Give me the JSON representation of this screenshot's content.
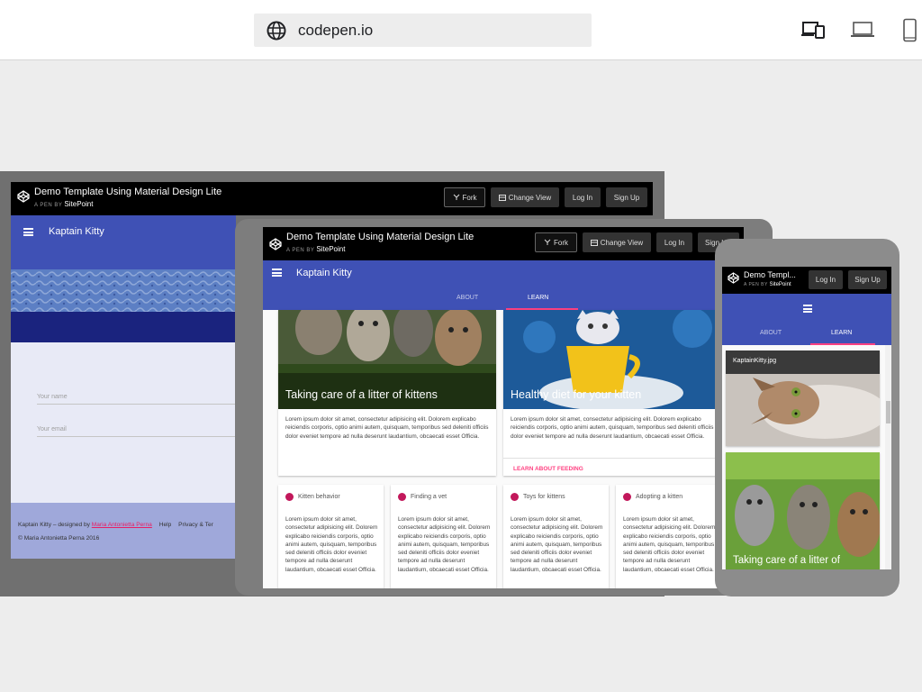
{
  "browser": {
    "url": "codepen.io",
    "icons": [
      "globe-icon",
      "responsive-devices-icon",
      "laptop-icon",
      "phone-icon"
    ]
  },
  "codepen": {
    "title": "Demo Template Using Material Design Lite",
    "title_short": "Demo Templ...",
    "byline_prefix": "A PEN BY",
    "author": "SitePoint",
    "fork": "Fork",
    "change_view": "Change View",
    "login": "Log In",
    "signup": "Sign Up"
  },
  "app": {
    "title": "Kaptain Kitty",
    "tabs": {
      "about": "ABOUT",
      "learn": "LEARN"
    },
    "form": {
      "name_placeholder": "Your name",
      "email_placeholder": "Your email"
    },
    "footer": {
      "designed_by_prefix": "Kaptain Kitty – designed by",
      "designer": "Maria Antonietta Perna",
      "help": "Help",
      "privacy": "Privacy & Ter",
      "copyright": "© Maria Antonietta Perna 2016"
    },
    "cards": [
      {
        "title": "Taking care of a litter of kittens",
        "text": "Lorem ipsum dolor sit amet, consectetur adipisicing elit. Dolorem explicabo reiciendis corporis, optio animi autem, quisquam, temporibus sed deleniti officiis dolor eveniet tempore ad nulla deserunt laudantium, obcaecati esset Officia."
      },
      {
        "title": "Healthy diet for your kitten",
        "text": "Lorem ipsum dolor sit amet, consectetur adipisicing elit. Dolorem explicabo reiciendis corporis, optio animi autem, quisquam, temporibus sed deleniti officiis dolor eveniet tempore ad nulla deserunt laudantium, obcaecati esset Officia.",
        "action": "LEARN ABOUT FEEDING"
      }
    ],
    "topics": [
      {
        "title": "Kitten behavior",
        "text": "Lorem ipsum dolor sit amet, consectetur adipisicing elit. Dolorem explicabo reiciendis corporis, optio animi autem, quisquam, temporibus sed deleniti officiis dolor eveniet tempore ad nulla deserunt laudantium, obcaecati esset Officia."
      },
      {
        "title": "Finding a vet",
        "text": "Lorem ipsum dolor sit amet, consectetur adipisicing elit. Dolorem explicabo reiciendis corporis, optio animi autem, quisquam, temporibus sed deleniti officiis dolor eveniet tempore ad nulla deserunt laudantium, obcaecati esset Officia."
      },
      {
        "title": "Toys for kittens",
        "text": "Lorem ipsum dolor sit amet, consectetur adipisicing elit. Dolorem explicabo reiciendis corporis, optio animi autem, quisquam, temporibus sed deleniti officiis dolor eveniet tempore ad nulla deserunt laudantium, obcaecati esset Officia."
      },
      {
        "title": "Adopting a kitten",
        "text": "Lorem ipsum dolor sit amet, consectetur adipisicing elit. Dolorem explicabo reiciendis corporis, optio animi autem, quisquam, temporibus sed deleniti officiis dolor eveniet tempore ad nulla deserunt laudantium, obcaecati esset Officia."
      }
    ],
    "mobile": {
      "image_caption": "KaptainKitty.jpg",
      "card_title": "Taking care of a litter of"
    }
  },
  "colors": {
    "primary": "#3f51b5",
    "primary_dark": "#1a237e",
    "accent": "#ff4081",
    "topic_dot": "#c2185b"
  }
}
